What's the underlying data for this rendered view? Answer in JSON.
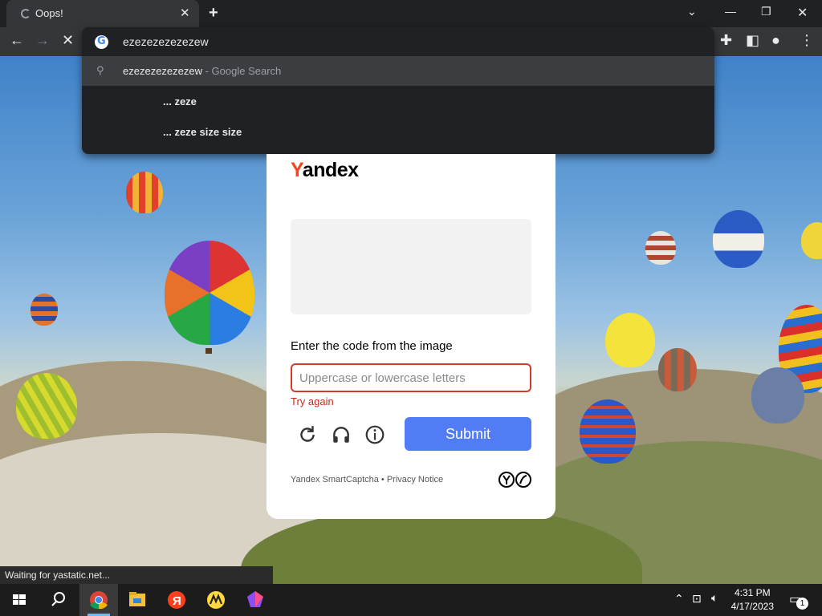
{
  "browser": {
    "tab_title": "Oops!",
    "tab_close": "✕",
    "new_tab": "+",
    "omnibox_text": "ezezezezezezew",
    "suggestions": [
      {
        "icon": "search-icon",
        "text": "ezezezezezezew",
        "suffix": " - Google Search"
      },
      {
        "icon": "",
        "text": "... zeze"
      },
      {
        "icon": "",
        "text": "... zeze size size"
      }
    ],
    "status_text": "Waiting for yastatic.net..."
  },
  "captcha": {
    "logo_first": "Y",
    "logo_rest": "andex",
    "prompt": "Enter the code from the image",
    "input_placeholder": "Uppercase or lowercase letters",
    "error": "Try again",
    "submit_label": "Submit",
    "footer": "Yandex SmartCaptcha • Privacy Notice",
    "accent": "#527cf5",
    "error_color": "#d23b2e"
  },
  "taskbar": {
    "time": "4:31 PM",
    "date": "4/17/2023",
    "notification_count": "1",
    "apps": [
      "start-icon",
      "search-icon",
      "chrome-icon",
      "file-explorer-icon",
      "yandex-browser-icon",
      "yandex-market-icon",
      "app-gem-icon"
    ]
  }
}
